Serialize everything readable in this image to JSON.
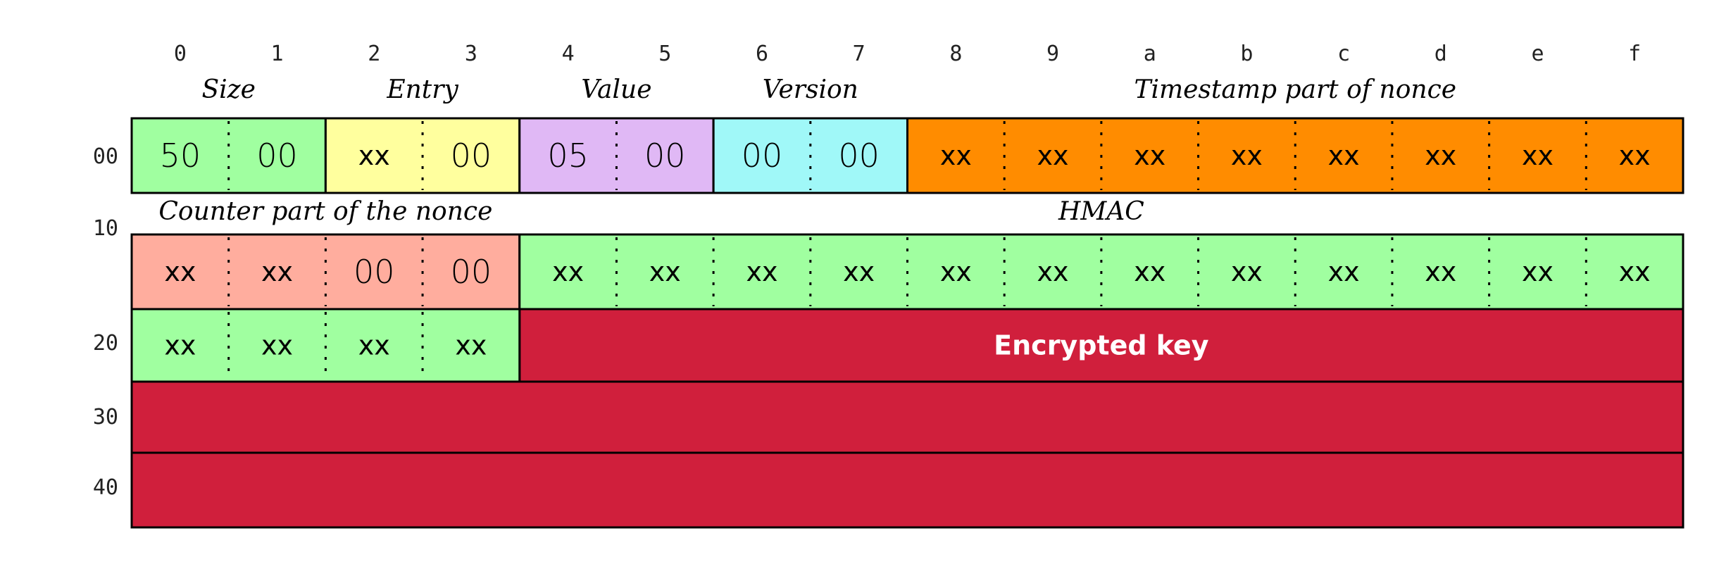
{
  "columns": [
    "0",
    "1",
    "2",
    "3",
    "4",
    "5",
    "6",
    "7",
    "8",
    "9",
    "a",
    "b",
    "c",
    "d",
    "e",
    "f"
  ],
  "rows": [
    "00",
    "10",
    "20",
    "30",
    "40"
  ],
  "fields": [
    {
      "label": "Size",
      "row": 0,
      "start": 0,
      "len": 2,
      "color": "#a0ffa0",
      "values": [
        "50",
        "00"
      ]
    },
    {
      "label": "Entry",
      "row": 0,
      "start": 2,
      "len": 2,
      "color": "#ffff9e",
      "values": [
        "xx",
        "00"
      ]
    },
    {
      "label": "Value",
      "row": 0,
      "start": 4,
      "len": 2,
      "color": "#e0b8f5",
      "values": [
        "05",
        "00"
      ]
    },
    {
      "label": "Version",
      "row": 0,
      "start": 6,
      "len": 2,
      "color": "#a0f8f8",
      "values": [
        "00",
        "00"
      ]
    },
    {
      "label": "Timestamp part of nonce",
      "row": 0,
      "start": 8,
      "len": 8,
      "color": "#ff8c00",
      "values": [
        "xx",
        "xx",
        "xx",
        "xx",
        "xx",
        "xx",
        "xx",
        "xx"
      ]
    },
    {
      "label": "Counter part of the nonce",
      "row": 1,
      "start": 0,
      "len": 4,
      "color": "#ffad9e",
      "values": [
        "xx",
        "xx",
        "00",
        "00"
      ]
    },
    {
      "label": "HMAC",
      "row": 1,
      "start": 4,
      "len": 12,
      "color": "#a0ffa0",
      "values": [
        "xx",
        "xx",
        "xx",
        "xx",
        "xx",
        "xx",
        "xx",
        "xx",
        "xx",
        "xx",
        "xx",
        "xx"
      ]
    },
    {
      "label": "",
      "row": 2,
      "start": 0,
      "len": 4,
      "color": "#a0ffa0",
      "values": [
        "xx",
        "xx",
        "xx",
        "xx"
      ]
    }
  ],
  "encrypted": {
    "label": "Encrypted key",
    "color": "#d01f3c"
  }
}
